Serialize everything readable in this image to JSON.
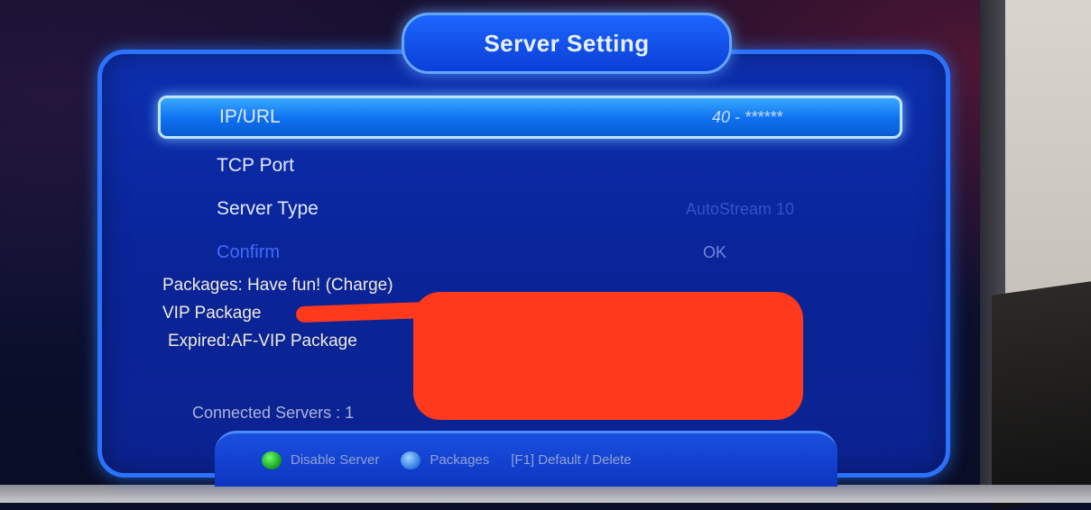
{
  "title": "Server Setting",
  "menu": [
    {
      "label": "IP/URL",
      "value": "40 - ******"
    },
    {
      "label": "TCP Port",
      "value": ""
    },
    {
      "label": "Server Type",
      "value": "AutoStream 10"
    },
    {
      "label": "Confirm",
      "value": "OK"
    }
  ],
  "info": {
    "packages": "Packages: Have fun! (Charge)",
    "vip": "VIP Package",
    "expired": "Expired:AF-VIP Package"
  },
  "connected": "Connected Servers : 1",
  "footer": {
    "disable": "Disable Server",
    "packages": "Packages",
    "f1": "[F1]  Default / Delete"
  },
  "colors": {
    "accent": "#2a73ff",
    "selected": "#37a8ff",
    "redaction": "#ff3a1c",
    "green_key": "#0e9a1d",
    "blue_key": "#2a78e0"
  }
}
